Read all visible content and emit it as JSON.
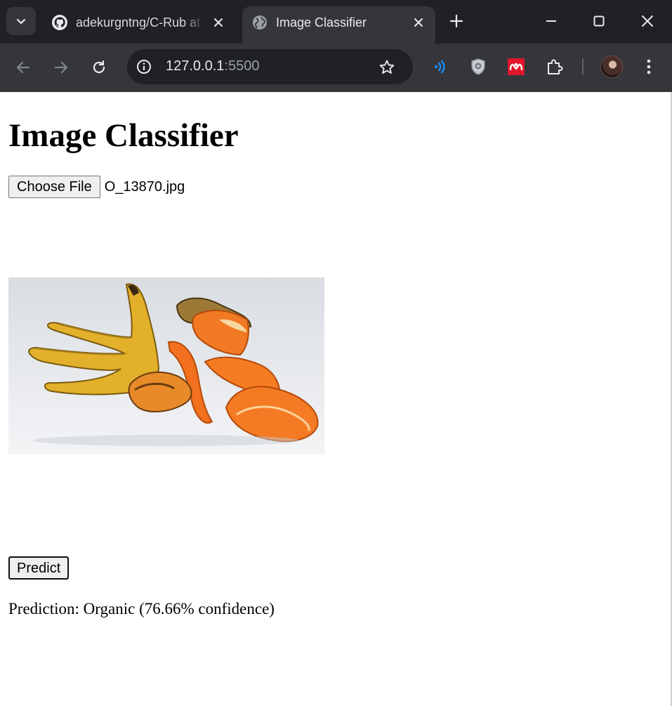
{
  "browser": {
    "tabs": [
      {
        "title": "adekurgntng/C-Rub at",
        "icon": "github-icon",
        "active": false
      },
      {
        "title": "Image Classifier",
        "icon": "globe-icon",
        "active": true
      }
    ],
    "address": {
      "host": "127.0.0.1",
      "port": ":5500"
    },
    "colors": {
      "tabstrip": "#202124",
      "toolbar": "#35363a",
      "text": "#e8eaed"
    }
  },
  "page": {
    "title": "Image Classifier",
    "file_input": {
      "button_label": "Choose File",
      "file_name": "O_13870.jpg"
    },
    "image": {
      "description_icon": "uploaded-image-preview"
    },
    "predict_label": "Predict",
    "prediction_text": "Prediction: Organic (76.66% confidence)"
  }
}
